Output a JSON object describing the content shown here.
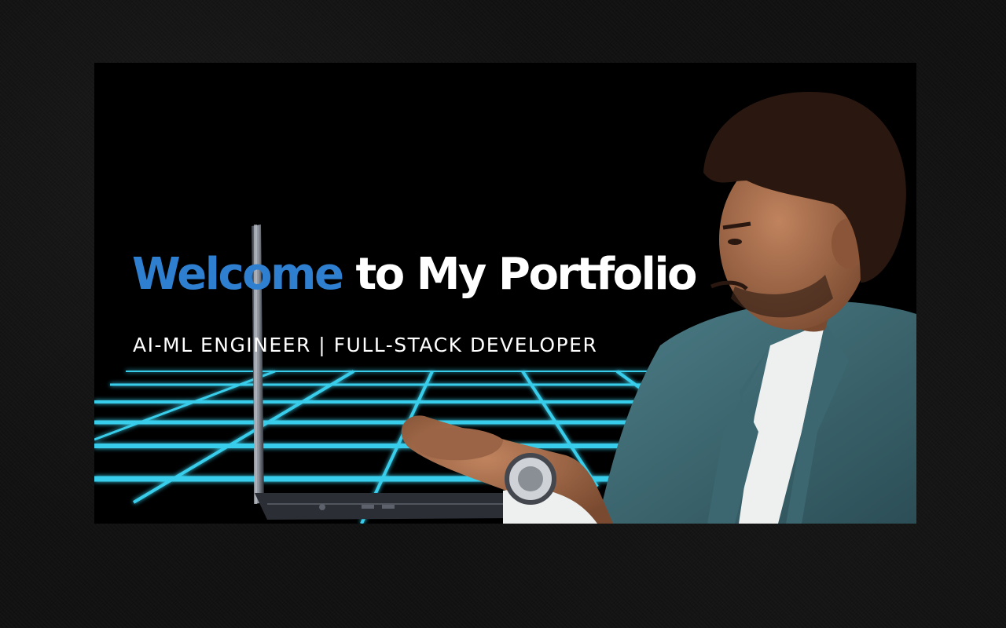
{
  "hero": {
    "title_highlight": "Welcome",
    "title_rest": "to My Portfolio",
    "subtitle": "AI-ML ENGINEER | FULL-STACK DEVELOPER"
  },
  "colors": {
    "accent": "#2f7fd0",
    "text": "#ffffff",
    "grid": "#3ee0ff",
    "background": "#000000",
    "suit": "#3c6770"
  },
  "images": {
    "portrait": "person-typing-on-laptop",
    "floor": "neon-grid"
  }
}
